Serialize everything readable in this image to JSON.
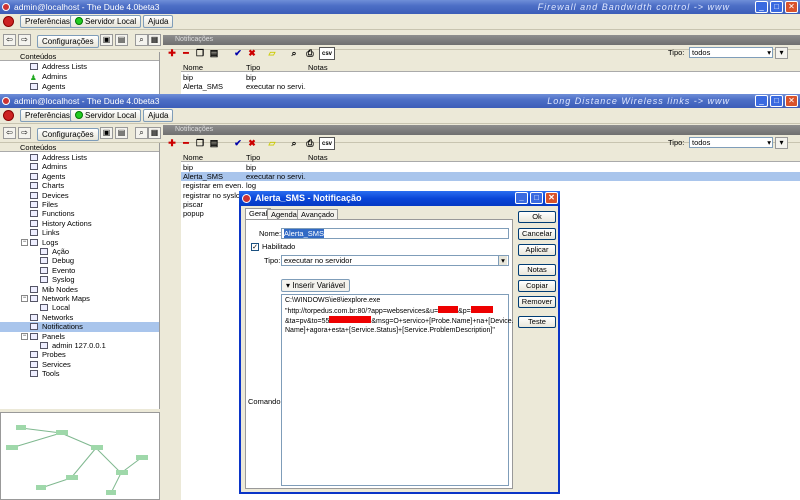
{
  "window1": {
    "title": "admin@localhost - The Dude 4.0beta3",
    "slogan": "Firewall and Bandwidth control -> www",
    "menu": {
      "prefs": "Preferências",
      "server": "Servidor Local",
      "help": "Ajuda"
    },
    "config": "Configurações",
    "panel_title": "Notificações",
    "tipo_label": "Tipo:",
    "tipo_value": "todos",
    "tree_header": "Conteúdos",
    "tree": [
      "Address Lists",
      "Admins",
      "Agents"
    ],
    "columns": {
      "name": "Nome",
      "type": "Tipo",
      "notes": "Notas"
    },
    "rows": [
      {
        "name": "bip",
        "type": "bip"
      },
      {
        "name": "Alerta_SMS",
        "type": "executar no servi..."
      }
    ]
  },
  "window2": {
    "title": "admin@localhost - The Dude 4.0beta3",
    "slogan": "Long Distance Wireless links -> www",
    "menu": {
      "prefs": "Preferências",
      "server": "Servidor Local",
      "help": "Ajuda"
    },
    "config": "Configurações",
    "panel_title": "Notificações",
    "tipo_label": "Tipo:",
    "tipo_value": "todos",
    "tree_header": "Conteúdos",
    "tree": [
      {
        "label": "Address Lists",
        "level": 1
      },
      {
        "label": "Admins",
        "level": 1
      },
      {
        "label": "Agents",
        "level": 1
      },
      {
        "label": "Charts",
        "level": 1
      },
      {
        "label": "Devices",
        "level": 1
      },
      {
        "label": "Files",
        "level": 1
      },
      {
        "label": "Functions",
        "level": 1
      },
      {
        "label": "History Actions",
        "level": 1
      },
      {
        "label": "Links",
        "level": 1
      },
      {
        "label": "Logs",
        "level": 1,
        "expanded": true
      },
      {
        "label": "Ação",
        "level": 2
      },
      {
        "label": "Debug",
        "level": 2
      },
      {
        "label": "Evento",
        "level": 2
      },
      {
        "label": "Syslog",
        "level": 2
      },
      {
        "label": "Mib Nodes",
        "level": 1
      },
      {
        "label": "Network Maps",
        "level": 1,
        "expanded": true
      },
      {
        "label": "Local",
        "level": 2
      },
      {
        "label": "Networks",
        "level": 1
      },
      {
        "label": "Notifications",
        "level": 1,
        "selected": true
      },
      {
        "label": "Panels",
        "level": 1,
        "expanded": true
      },
      {
        "label": "admin 127.0.0.1",
        "level": 2
      },
      {
        "label": "Probes",
        "level": 1
      },
      {
        "label": "Services",
        "level": 1
      },
      {
        "label": "Tools",
        "level": 1
      }
    ],
    "columns": {
      "name": "Nome",
      "type": "Tipo",
      "notes": "Notas"
    },
    "rows": [
      {
        "name": "bip",
        "type": "bip"
      },
      {
        "name": "Alerta_SMS",
        "type": "executar no servi...",
        "selected": true
      },
      {
        "name": "registrar em even...",
        "type": "log"
      },
      {
        "name": "registrar no syslog",
        "type": "syslog"
      },
      {
        "name": "piscar",
        "type": "piscar"
      },
      {
        "name": "popup",
        "type": "popup"
      }
    ]
  },
  "dialog": {
    "title": "Alerta_SMS - Notificação",
    "tabs": [
      "Geral",
      "Agenda",
      "Avançado"
    ],
    "nome_label": "Nome:",
    "nome_value": "Alerta_SMS",
    "habilitado_label": "Habilitado",
    "tipo_label": "Tipo:",
    "tipo_value": "executar no servidor",
    "insert_var": "Inserir Variável",
    "comando_label": "Comando:",
    "command_lines": [
      "C:\\WINDOWS\\ie8\\iexplore.exe",
      "\"http://torpedus.com.br:80/?app=webservices&u=",
      "&ta=pv&to=55",
      "Name]+agora+esta+[Service.Status]+[Service.ProblemDescription]\""
    ],
    "command_parts": {
      "l2_mid": "&p=",
      "l3_end": "&msg=O+servico+[Probe.Name]+na+[Device."
    },
    "buttons": [
      "Ok",
      "Cancelar",
      "Aplicar",
      "Notas",
      "Copiar",
      "Remover",
      "Teste"
    ]
  },
  "colors": {
    "titlebar": "#3c5db8",
    "selection": "#a9c5ec",
    "dialog_title": "#0a46d8",
    "redaction": "#e00000"
  }
}
